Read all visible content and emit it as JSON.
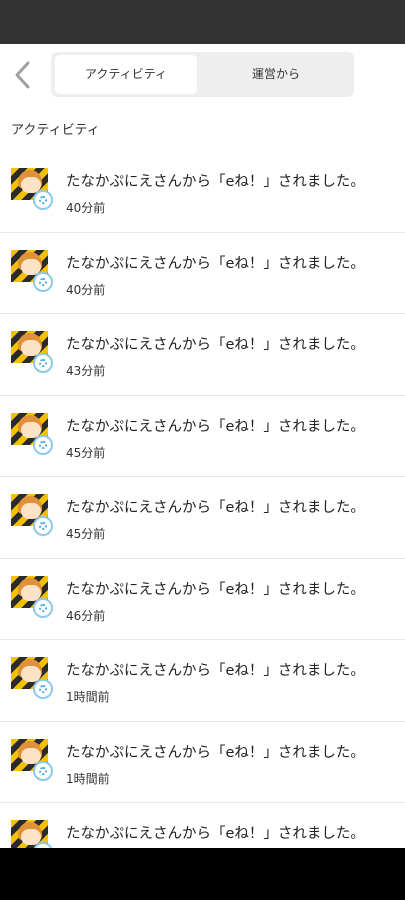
{
  "tabs": {
    "active": "アクティビティ",
    "inactive": "運営から"
  },
  "section_title": "アクティビティ",
  "notifications": [
    {
      "message": "たなかぷにえさんから「eね！」されました。",
      "time": "40分前"
    },
    {
      "message": "たなかぷにえさんから「eね！」されました。",
      "time": "40分前"
    },
    {
      "message": "たなかぷにえさんから「eね！」されました。",
      "time": "43分前"
    },
    {
      "message": "たなかぷにえさんから「eね！」されました。",
      "time": "45分前"
    },
    {
      "message": "たなかぷにえさんから「eね！」されました。",
      "time": "45分前"
    },
    {
      "message": "たなかぷにえさんから「eね！」されました。",
      "time": "46分前"
    },
    {
      "message": "たなかぷにえさんから「eね！」されました。",
      "time": "1時間前"
    },
    {
      "message": "たなかぷにえさんから「eね！」されました。",
      "time": "1時間前"
    },
    {
      "message": "たなかぷにえさんから「eね！」されました。",
      "time": ""
    }
  ]
}
